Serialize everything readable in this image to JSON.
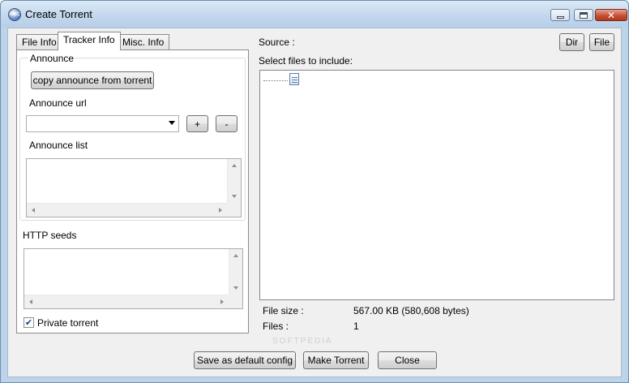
{
  "window": {
    "title": "Create Torrent",
    "app_icon_text": "ABC"
  },
  "tabs": [
    {
      "label": "File Info",
      "active": false
    },
    {
      "label": "Tracker Info",
      "active": true
    },
    {
      "label": "Misc. Info",
      "active": false
    }
  ],
  "announce": {
    "group_label": "Announce",
    "copy_button": "copy announce from torrent",
    "url_label": "Announce url",
    "url_value": "",
    "add_button": "+",
    "remove_button": "-",
    "list_label": "Announce list",
    "list_items": []
  },
  "http_seeds": {
    "label": "HTTP seeds",
    "items": []
  },
  "private_torrent": {
    "label": "Private torrent",
    "checked": true,
    "check_glyph": "✔"
  },
  "source": {
    "label": "Source :",
    "dir_button": "Dir",
    "file_button": "File",
    "include_label": "Select files to include:"
  },
  "stats": {
    "file_size_label": "File size :",
    "file_size_value": "567.00 KB (580,608 bytes)",
    "files_label": "Files :",
    "files_value": "1"
  },
  "footer": {
    "save_default": "Save as default config",
    "make_torrent": "Make Torrent",
    "close": "Close"
  },
  "watermark": "SOFTPEDIA"
}
